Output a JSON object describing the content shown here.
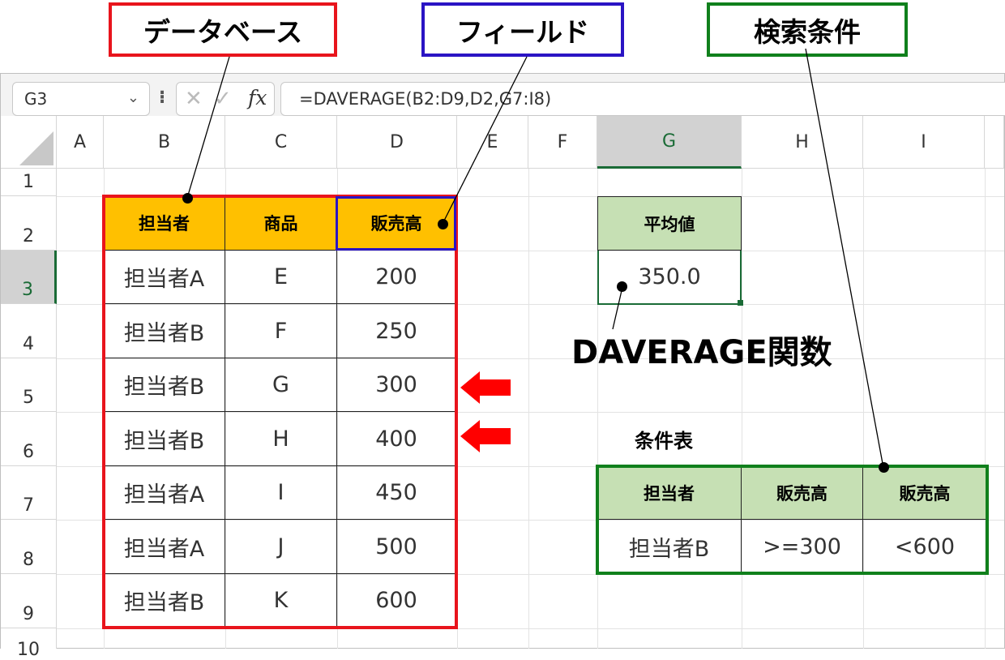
{
  "annotations": {
    "database": "データベース",
    "field": "フィールド",
    "criteria": "検索条件",
    "function_name": "DAVERAGE関数"
  },
  "formula_bar": {
    "name_box": "G3",
    "formula": "=DAVERAGE(B2:D9,D2,G7:I8)",
    "fx_label": "fx"
  },
  "columns": [
    "A",
    "B",
    "C",
    "D",
    "E",
    "F",
    "G",
    "H",
    "I"
  ],
  "rows": [
    "1",
    "2",
    "3",
    "4",
    "5",
    "6",
    "7",
    "8",
    "9",
    "10"
  ],
  "database_table": {
    "headers": [
      "担当者",
      "商品",
      "販売高"
    ],
    "rows": [
      [
        "担当者A",
        "E",
        "200"
      ],
      [
        "担当者B",
        "F",
        "250"
      ],
      [
        "担当者B",
        "G",
        "300"
      ],
      [
        "担当者B",
        "H",
        "400"
      ],
      [
        "担当者A",
        "I",
        "450"
      ],
      [
        "担当者A",
        "J",
        "500"
      ],
      [
        "担当者B",
        "K",
        "600"
      ]
    ]
  },
  "result": {
    "header": "平均値",
    "value": "350.0"
  },
  "criteria_table": {
    "title": "条件表",
    "headers": [
      "担当者",
      "販売高",
      "販売高"
    ],
    "values": [
      "担当者B",
      ">=300",
      "<600"
    ]
  },
  "colors": {
    "database_border": "#e8141c",
    "field_border": "#2a14c4",
    "criteria_border": "#10801c",
    "header_fill": "#ffc000",
    "criteria_fill": "#c6e0b4",
    "arrow": "#ff0000"
  }
}
